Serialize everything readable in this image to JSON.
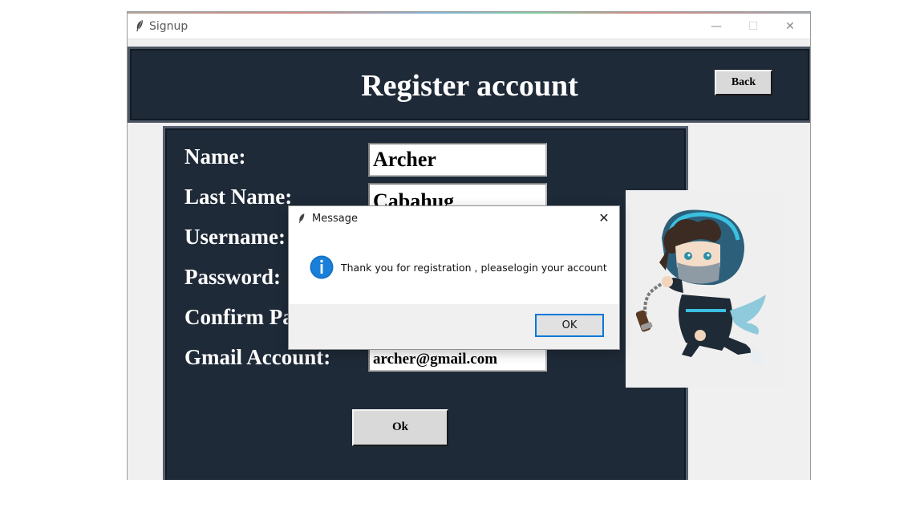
{
  "window": {
    "title": "Signup",
    "icon": "feather-icon",
    "controls": {
      "minimize": "—",
      "maximize": "☐",
      "close": "✕"
    }
  },
  "header": {
    "heading": "Register account",
    "back_label": "Back",
    "background": "#1f2a38"
  },
  "form": {
    "fields": [
      {
        "label": "Name:",
        "value": "Archer"
      },
      {
        "label": "Last Name:",
        "value": "Cabahug"
      },
      {
        "label": "Username:",
        "value": ""
      },
      {
        "label": "Password:",
        "value": ""
      },
      {
        "label": "Confirm Pa",
        "value": ""
      },
      {
        "label": "Gmail Account:",
        "value": "archer@gmail.com"
      }
    ],
    "ok_label": "Ok"
  },
  "image": {
    "icon": "ninja-character-illustration"
  },
  "dialog": {
    "title": "Message",
    "icon": "info-icon",
    "message": "Thank you for registration , pleaselogin your account",
    "ok_label": "OK",
    "close": "✕",
    "accent": "#0078d7"
  }
}
